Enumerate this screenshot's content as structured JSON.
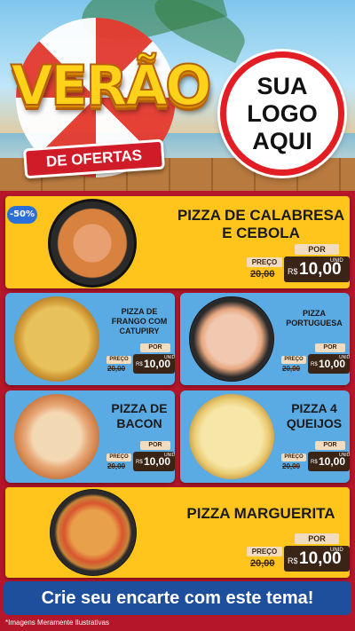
{
  "header": {
    "title": "VERÃO",
    "subtitle": "DE OFERTAS",
    "logo_placeholder": "SUA\nLOGO\nAQUI"
  },
  "badge": "-50%",
  "products": [
    {
      "name": "PIZZA DE CALABRESA\nE CEBOLA",
      "preco_label": "PREÇO",
      "old_price": "20,00",
      "por_label": "POR",
      "currency": "R$",
      "price": "10,00",
      "unit": "UNID"
    },
    {
      "name": "PIZZA DE\nFRANGO COM\nCATUPIRY",
      "preco_label": "PREÇO",
      "old_price": "20,00",
      "por_label": "POR",
      "currency": "R$",
      "price": "10,00",
      "unit": "UNID"
    },
    {
      "name": "PIZZA\nPORTUGUESA",
      "preco_label": "PREÇO",
      "old_price": "20,00",
      "por_label": "POR",
      "currency": "R$",
      "price": "10,00",
      "unit": "UNID"
    },
    {
      "name": "PIZZA DE\nBACON",
      "preco_label": "PREÇO",
      "old_price": "20,00",
      "por_label": "POR",
      "currency": "R$",
      "price": "10,00",
      "unit": "UNID"
    },
    {
      "name": "PIZZA 4\nQUEIJOS",
      "preco_label": "PREÇO",
      "old_price": "20,00",
      "por_label": "POR",
      "currency": "R$",
      "price": "10,00",
      "unit": "UNID"
    },
    {
      "name": "PIZZA MARGUERITA",
      "preco_label": "PREÇO",
      "old_price": "20,00",
      "por_label": "POR",
      "currency": "R$",
      "price": "10,00",
      "unit": "UNID"
    }
  ],
  "footer": {
    "cta": "Crie seu encarte com este tema!",
    "disclaimer": "*Imagens Meramente Ilustrativas"
  },
  "colors": {
    "background_red": "#b5162a",
    "panel_yellow": "#ffc51d",
    "panel_blue": "#5aaae4",
    "price_dark": "#3a2416",
    "cta_blue": "#1e4f9c"
  },
  "icons": [
    "pizza-calabresa-image",
    "pizza-frango-image",
    "pizza-portuguesa-image",
    "pizza-bacon-image",
    "pizza-queijos-image",
    "pizza-marguerita-image",
    "lifebuoy-icon"
  ]
}
